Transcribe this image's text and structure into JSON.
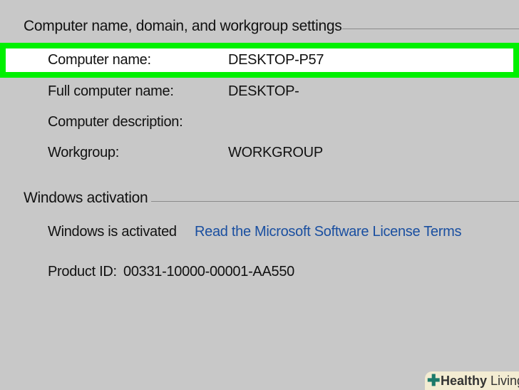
{
  "sections": {
    "computer_name": {
      "title": "Computer name, domain, and workgroup settings",
      "rows": [
        {
          "label": "Computer name:",
          "value": "DESKTOP-P57"
        },
        {
          "label": "Full computer name:",
          "value": "DESKTOP-"
        },
        {
          "label": "Computer description:",
          "value": ""
        },
        {
          "label": "Workgroup:",
          "value": "WORKGROUP"
        }
      ]
    },
    "activation": {
      "title": "Windows activation",
      "status": "Windows is activated",
      "link": "Read the Microsoft Software License Terms",
      "product_id_label": "Product ID:",
      "product_id": "00331-10000-00001-AA550"
    }
  },
  "watermark": {
    "bold": "Healthy",
    "rest": " Living"
  },
  "colors": {
    "highlight": "#00f000",
    "link": "#1a4fa0"
  }
}
